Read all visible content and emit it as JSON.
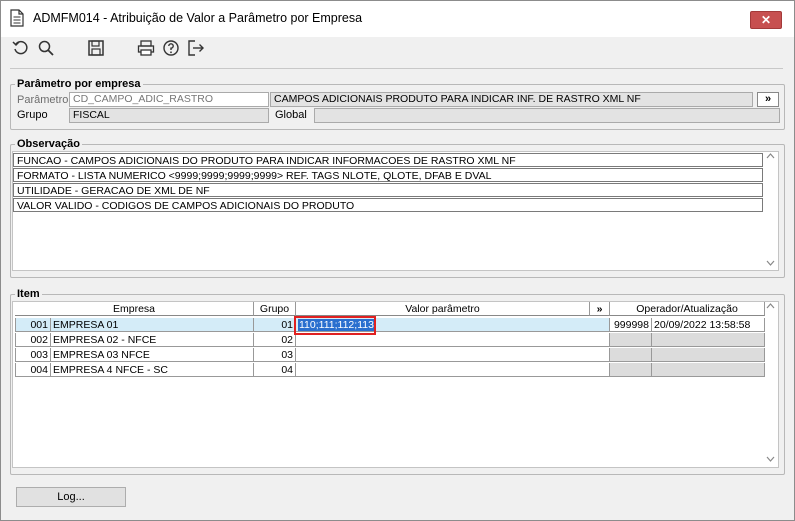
{
  "window": {
    "title": "ADMFM014 - Atribuição de Valor a Parâmetro por Empresa",
    "close_label": "✕"
  },
  "toolbar": {
    "icons": [
      "refresh-icon",
      "search-icon",
      "save-icon",
      "print-icon",
      "help-icon",
      "exit-icon"
    ]
  },
  "param_section": {
    "legend": "Parâmetro por empresa",
    "parametro_label": "Parâmetro",
    "parametro_value": "CD_CAMPO_ADIC_RASTRO",
    "parametro_desc": "CAMPOS ADICIONAIS PRODUTO PARA INDICAR INF. DE RASTRO XML NF",
    "expand_label": "»",
    "grupo_label": "Grupo",
    "grupo_value": "FISCAL",
    "global_label": "Global",
    "global_value": ""
  },
  "obs_section": {
    "legend": "Observação",
    "lines": [
      "FUNCAO - CAMPOS ADICIONAIS DO PRODUTO PARA INDICAR INFORMACOES DE RASTRO XML NF",
      "FORMATO - LISTA NUMERICO <9999;9999;9999;9999> REF. TAGS NLOTE, QLOTE, DFAB E DVAL",
      "UTILIDADE - GERACAO DE XML DE NF",
      "VALOR VALIDO - CODIGOS DE CAMPOS ADICIONAIS DO PRODUTO"
    ]
  },
  "item_section": {
    "legend": "Item",
    "headers": {
      "empresa": "Empresa",
      "grupo": "Grupo",
      "valor": "Valor parâmetro",
      "expand": "»",
      "operador": "Operador/Atualização"
    },
    "rows": [
      {
        "code": "001",
        "empresa": "EMPRESA 01",
        "grupo": "01",
        "valor": "110;111;112;113",
        "operador": "999998",
        "atualizacao": "20/09/2022 13:58:58"
      },
      {
        "code": "002",
        "empresa": "EMPRESA 02 - NFCE",
        "grupo": "02",
        "valor": "",
        "operador": "",
        "atualizacao": ""
      },
      {
        "code": "003",
        "empresa": "EMPRESA 03 NFCE",
        "grupo": "03",
        "valor": "",
        "operador": "",
        "atualizacao": ""
      },
      {
        "code": "004",
        "empresa": "EMPRESA 4 NFCE - SC",
        "grupo": "04",
        "valor": "",
        "operador": "",
        "atualizacao": ""
      }
    ]
  },
  "footer": {
    "log_label": "Log..."
  }
}
